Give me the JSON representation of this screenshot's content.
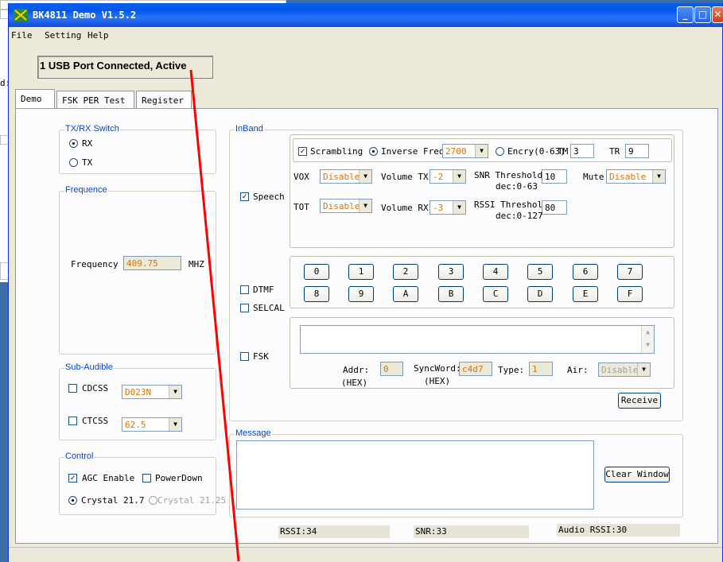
{
  "background_window": {
    "label_fragment": "d:"
  },
  "window": {
    "title": "BK4811 Demo V1.5.2",
    "min_glyph": "_",
    "max_glyph": "□",
    "close_glyph": "✕"
  },
  "menu": {
    "items": [
      "File",
      "Setting",
      "Help"
    ]
  },
  "status_text": "1 USB Port Connected, Active",
  "tabs": [
    "Demo",
    "FSK PER Test",
    "Register"
  ],
  "txrx": {
    "legend": "TX/RX Switch",
    "rx": "RX",
    "tx": "TX",
    "selected": "RX"
  },
  "frequence": {
    "legend": "Frequence",
    "label": "Frequency",
    "value": "409.75",
    "unit": "MHZ"
  },
  "subaudible": {
    "legend": "Sub-Audible",
    "cdcss_label": "CDCSS",
    "cdcss_value": "D023N",
    "ctcss_label": "CTCSS",
    "ctcss_value": "62.5"
  },
  "control": {
    "legend": "Control",
    "agc_label": "AGC Enable",
    "powerdown_label": "PowerDown",
    "crystal1": "Crystal 21.7",
    "crystal2": "Crystal 21.25"
  },
  "inband": {
    "legend": "InBand",
    "speech_label": "Speech",
    "scrambling_label": "Scrambling",
    "inverse_freq_label": "Inverse Freq",
    "inverse_freq_value": "2700",
    "encry_label": "Encry(0-63)",
    "tm_label": "TM",
    "tm_value": "3",
    "tr_label": "TR",
    "tr_value": "9",
    "vox_label": "VOX",
    "vox_value": "Disable",
    "vol_tx_label": "Volume TX",
    "vol_tx_value": "-2",
    "snr_label": "SNR Threshold",
    "snr_range": "dec:0-63",
    "snr_value": "10",
    "mute_label": "Mute",
    "mute_value": "Disable",
    "tot_label": "TOT",
    "tot_value": "Disable",
    "vol_rx_label": "Volume RX",
    "vol_rx_value": "-3",
    "rssi_label": "RSSI Threshold",
    "rssi_range": "dec:0-127",
    "rssi_value": "80",
    "dtmf_label": "DTMF",
    "selcal_label": "SELCAL",
    "keys": [
      "0",
      "1",
      "2",
      "3",
      "4",
      "5",
      "6",
      "7",
      "8",
      "9",
      "A",
      "B",
      "C",
      "D",
      "E",
      "F"
    ],
    "fsk_label": "FSK",
    "addr_label": "Addr:",
    "addr_unit": "(HEX)",
    "addr_value": "0",
    "syncword_label": "SyncWord:",
    "syncword_unit": "(HEX)",
    "syncword_value": "c4d7",
    "type_label": "Type:",
    "type_value": "1",
    "air_label": "Air:",
    "air_value": "Disable",
    "receive_label": "Receive"
  },
  "message": {
    "legend": "Message",
    "clear_label": "Clear Window"
  },
  "statusbar": {
    "rssi": "RSSI:34",
    "snr": "SNR:33",
    "audio_rssi": "Audio RSSI:30"
  },
  "colors": {
    "title_bar": "#0058ee",
    "legend": "#0046d5",
    "field_value": "#e07000",
    "annotation_line": "#ff0000"
  }
}
